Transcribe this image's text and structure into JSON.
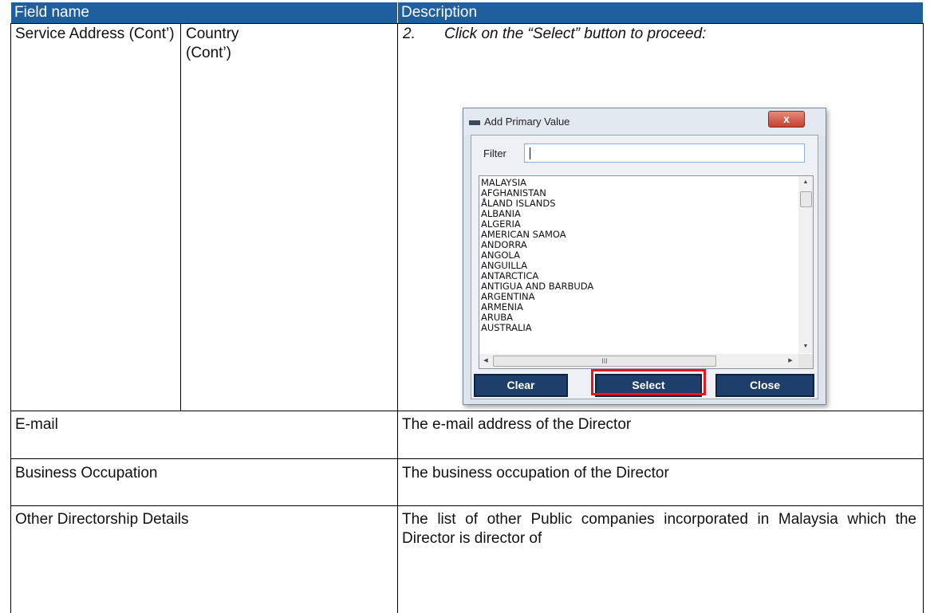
{
  "table": {
    "headers": {
      "field_name": "Field name",
      "description": "Description"
    },
    "row1": {
      "field_main": "Service Address (Cont’)",
      "field_sub": "Country (Cont’)",
      "step_number": "2.",
      "step_text": "Click on the “Select” button to proceed:"
    },
    "rows": [
      {
        "field": "E-mail",
        "description": "The e-mail address of the Director"
      },
      {
        "field": "Business Occupation",
        "description": "The business occupation of the Director"
      },
      {
        "field": "Other Directorship Details",
        "description": "The list of other Public companies incorporated in Malaysia which the Director is director of"
      }
    ]
  },
  "dialog": {
    "title": "Add Primary Value",
    "close_label": "x",
    "filter_label": "Filter",
    "filter_value": "",
    "list_items": [
      "MALAYSIA",
      "AFGHANISTAN",
      "ÅLAND ISLANDS",
      "ALBANIA",
      "ALGERIA",
      "AMERICAN SAMOA",
      "ANDORRA",
      "ANGOLA",
      "ANGUILLA",
      "ANTARCTICA",
      "ANTIGUA AND BARBUDA",
      "ARGENTINA",
      "ARMENIA",
      "ARUBA",
      "AUSTRALIA"
    ],
    "hscroll_grip": "III",
    "buttons": {
      "clear": "Clear",
      "select": "Select",
      "close": "Close"
    },
    "highlight_color": "#e0191f"
  },
  "colors": {
    "header_bg": "#1f5f9e",
    "button_bg": "#1f3f6b"
  }
}
